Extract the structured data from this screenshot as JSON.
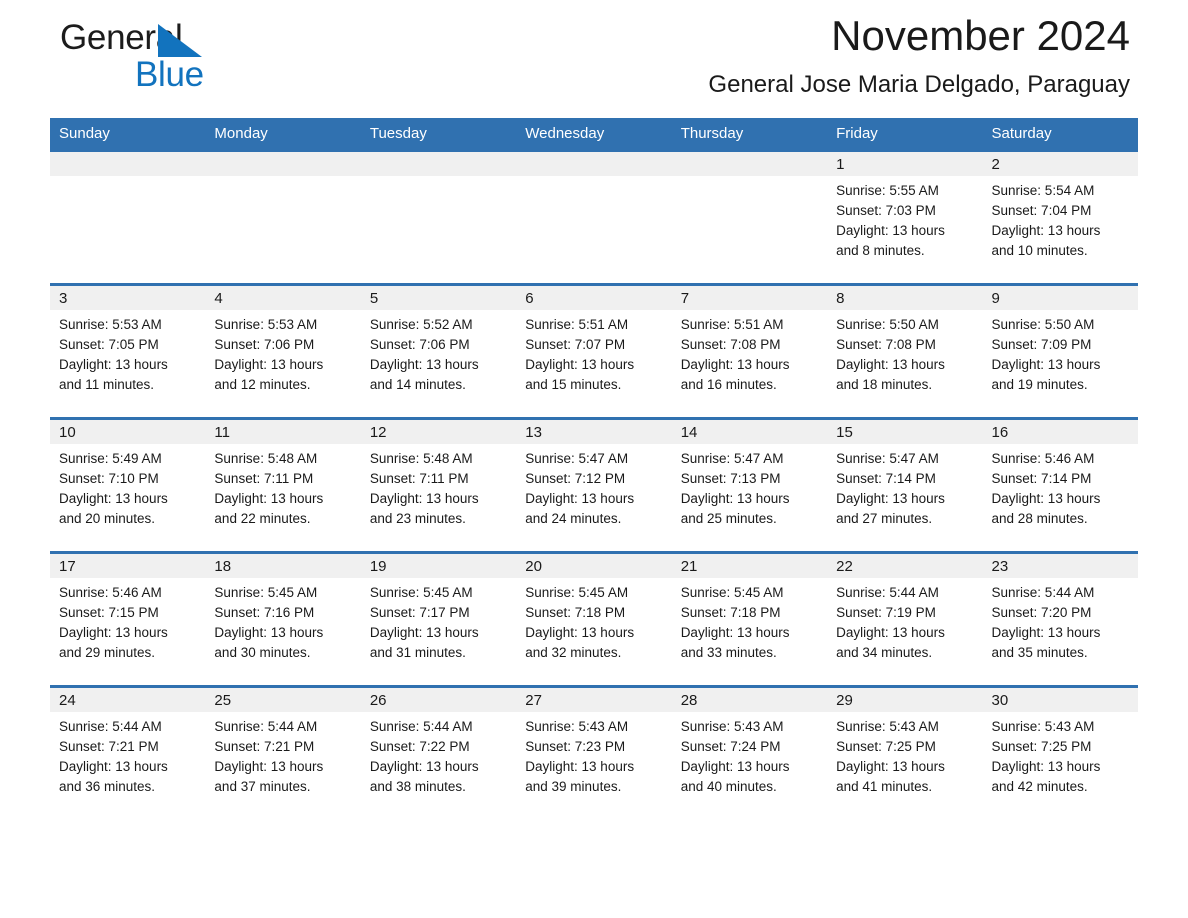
{
  "brand": {
    "name_top": "General",
    "name_bottom": "Blue",
    "mark": "triangle-logo",
    "accent_color": "#1273be"
  },
  "header": {
    "month_title": "November 2024",
    "location": "General Jose Maria Delgado, Paraguay"
  },
  "theme": {
    "header_blue": "#3071b0",
    "daynum_band": "#f0f0f0",
    "text": "#1a1a1a"
  },
  "weekday_headers": [
    "Sunday",
    "Monday",
    "Tuesday",
    "Wednesday",
    "Thursday",
    "Friday",
    "Saturday"
  ],
  "weeks": [
    [
      {
        "day": "",
        "lines": []
      },
      {
        "day": "",
        "lines": []
      },
      {
        "day": "",
        "lines": []
      },
      {
        "day": "",
        "lines": []
      },
      {
        "day": "",
        "lines": []
      },
      {
        "day": "1",
        "lines": [
          "Sunrise: 5:55 AM",
          "Sunset: 7:03 PM",
          "Daylight: 13 hours",
          "and 8 minutes."
        ]
      },
      {
        "day": "2",
        "lines": [
          "Sunrise: 5:54 AM",
          "Sunset: 7:04 PM",
          "Daylight: 13 hours",
          "and 10 minutes."
        ]
      }
    ],
    [
      {
        "day": "3",
        "lines": [
          "Sunrise: 5:53 AM",
          "Sunset: 7:05 PM",
          "Daylight: 13 hours",
          "and 11 minutes."
        ]
      },
      {
        "day": "4",
        "lines": [
          "Sunrise: 5:53 AM",
          "Sunset: 7:06 PM",
          "Daylight: 13 hours",
          "and 12 minutes."
        ]
      },
      {
        "day": "5",
        "lines": [
          "Sunrise: 5:52 AM",
          "Sunset: 7:06 PM",
          "Daylight: 13 hours",
          "and 14 minutes."
        ]
      },
      {
        "day": "6",
        "lines": [
          "Sunrise: 5:51 AM",
          "Sunset: 7:07 PM",
          "Daylight: 13 hours",
          "and 15 minutes."
        ]
      },
      {
        "day": "7",
        "lines": [
          "Sunrise: 5:51 AM",
          "Sunset: 7:08 PM",
          "Daylight: 13 hours",
          "and 16 minutes."
        ]
      },
      {
        "day": "8",
        "lines": [
          "Sunrise: 5:50 AM",
          "Sunset: 7:08 PM",
          "Daylight: 13 hours",
          "and 18 minutes."
        ]
      },
      {
        "day": "9",
        "lines": [
          "Sunrise: 5:50 AM",
          "Sunset: 7:09 PM",
          "Daylight: 13 hours",
          "and 19 minutes."
        ]
      }
    ],
    [
      {
        "day": "10",
        "lines": [
          "Sunrise: 5:49 AM",
          "Sunset: 7:10 PM",
          "Daylight: 13 hours",
          "and 20 minutes."
        ]
      },
      {
        "day": "11",
        "lines": [
          "Sunrise: 5:48 AM",
          "Sunset: 7:11 PM",
          "Daylight: 13 hours",
          "and 22 minutes."
        ]
      },
      {
        "day": "12",
        "lines": [
          "Sunrise: 5:48 AM",
          "Sunset: 7:11 PM",
          "Daylight: 13 hours",
          "and 23 minutes."
        ]
      },
      {
        "day": "13",
        "lines": [
          "Sunrise: 5:47 AM",
          "Sunset: 7:12 PM",
          "Daylight: 13 hours",
          "and 24 minutes."
        ]
      },
      {
        "day": "14",
        "lines": [
          "Sunrise: 5:47 AM",
          "Sunset: 7:13 PM",
          "Daylight: 13 hours",
          "and 25 minutes."
        ]
      },
      {
        "day": "15",
        "lines": [
          "Sunrise: 5:47 AM",
          "Sunset: 7:14 PM",
          "Daylight: 13 hours",
          "and 27 minutes."
        ]
      },
      {
        "day": "16",
        "lines": [
          "Sunrise: 5:46 AM",
          "Sunset: 7:14 PM",
          "Daylight: 13 hours",
          "and 28 minutes."
        ]
      }
    ],
    [
      {
        "day": "17",
        "lines": [
          "Sunrise: 5:46 AM",
          "Sunset: 7:15 PM",
          "Daylight: 13 hours",
          "and 29 minutes."
        ]
      },
      {
        "day": "18",
        "lines": [
          "Sunrise: 5:45 AM",
          "Sunset: 7:16 PM",
          "Daylight: 13 hours",
          "and 30 minutes."
        ]
      },
      {
        "day": "19",
        "lines": [
          "Sunrise: 5:45 AM",
          "Sunset: 7:17 PM",
          "Daylight: 13 hours",
          "and 31 minutes."
        ]
      },
      {
        "day": "20",
        "lines": [
          "Sunrise: 5:45 AM",
          "Sunset: 7:18 PM",
          "Daylight: 13 hours",
          "and 32 minutes."
        ]
      },
      {
        "day": "21",
        "lines": [
          "Sunrise: 5:45 AM",
          "Sunset: 7:18 PM",
          "Daylight: 13 hours",
          "and 33 minutes."
        ]
      },
      {
        "day": "22",
        "lines": [
          "Sunrise: 5:44 AM",
          "Sunset: 7:19 PM",
          "Daylight: 13 hours",
          "and 34 minutes."
        ]
      },
      {
        "day": "23",
        "lines": [
          "Sunrise: 5:44 AM",
          "Sunset: 7:20 PM",
          "Daylight: 13 hours",
          "and 35 minutes."
        ]
      }
    ],
    [
      {
        "day": "24",
        "lines": [
          "Sunrise: 5:44 AM",
          "Sunset: 7:21 PM",
          "Daylight: 13 hours",
          "and 36 minutes."
        ]
      },
      {
        "day": "25",
        "lines": [
          "Sunrise: 5:44 AM",
          "Sunset: 7:21 PM",
          "Daylight: 13 hours",
          "and 37 minutes."
        ]
      },
      {
        "day": "26",
        "lines": [
          "Sunrise: 5:44 AM",
          "Sunset: 7:22 PM",
          "Daylight: 13 hours",
          "and 38 minutes."
        ]
      },
      {
        "day": "27",
        "lines": [
          "Sunrise: 5:43 AM",
          "Sunset: 7:23 PM",
          "Daylight: 13 hours",
          "and 39 minutes."
        ]
      },
      {
        "day": "28",
        "lines": [
          "Sunrise: 5:43 AM",
          "Sunset: 7:24 PM",
          "Daylight: 13 hours",
          "and 40 minutes."
        ]
      },
      {
        "day": "29",
        "lines": [
          "Sunrise: 5:43 AM",
          "Sunset: 7:25 PM",
          "Daylight: 13 hours",
          "and 41 minutes."
        ]
      },
      {
        "day": "30",
        "lines": [
          "Sunrise: 5:43 AM",
          "Sunset: 7:25 PM",
          "Daylight: 13 hours",
          "and 42 minutes."
        ]
      }
    ]
  ]
}
